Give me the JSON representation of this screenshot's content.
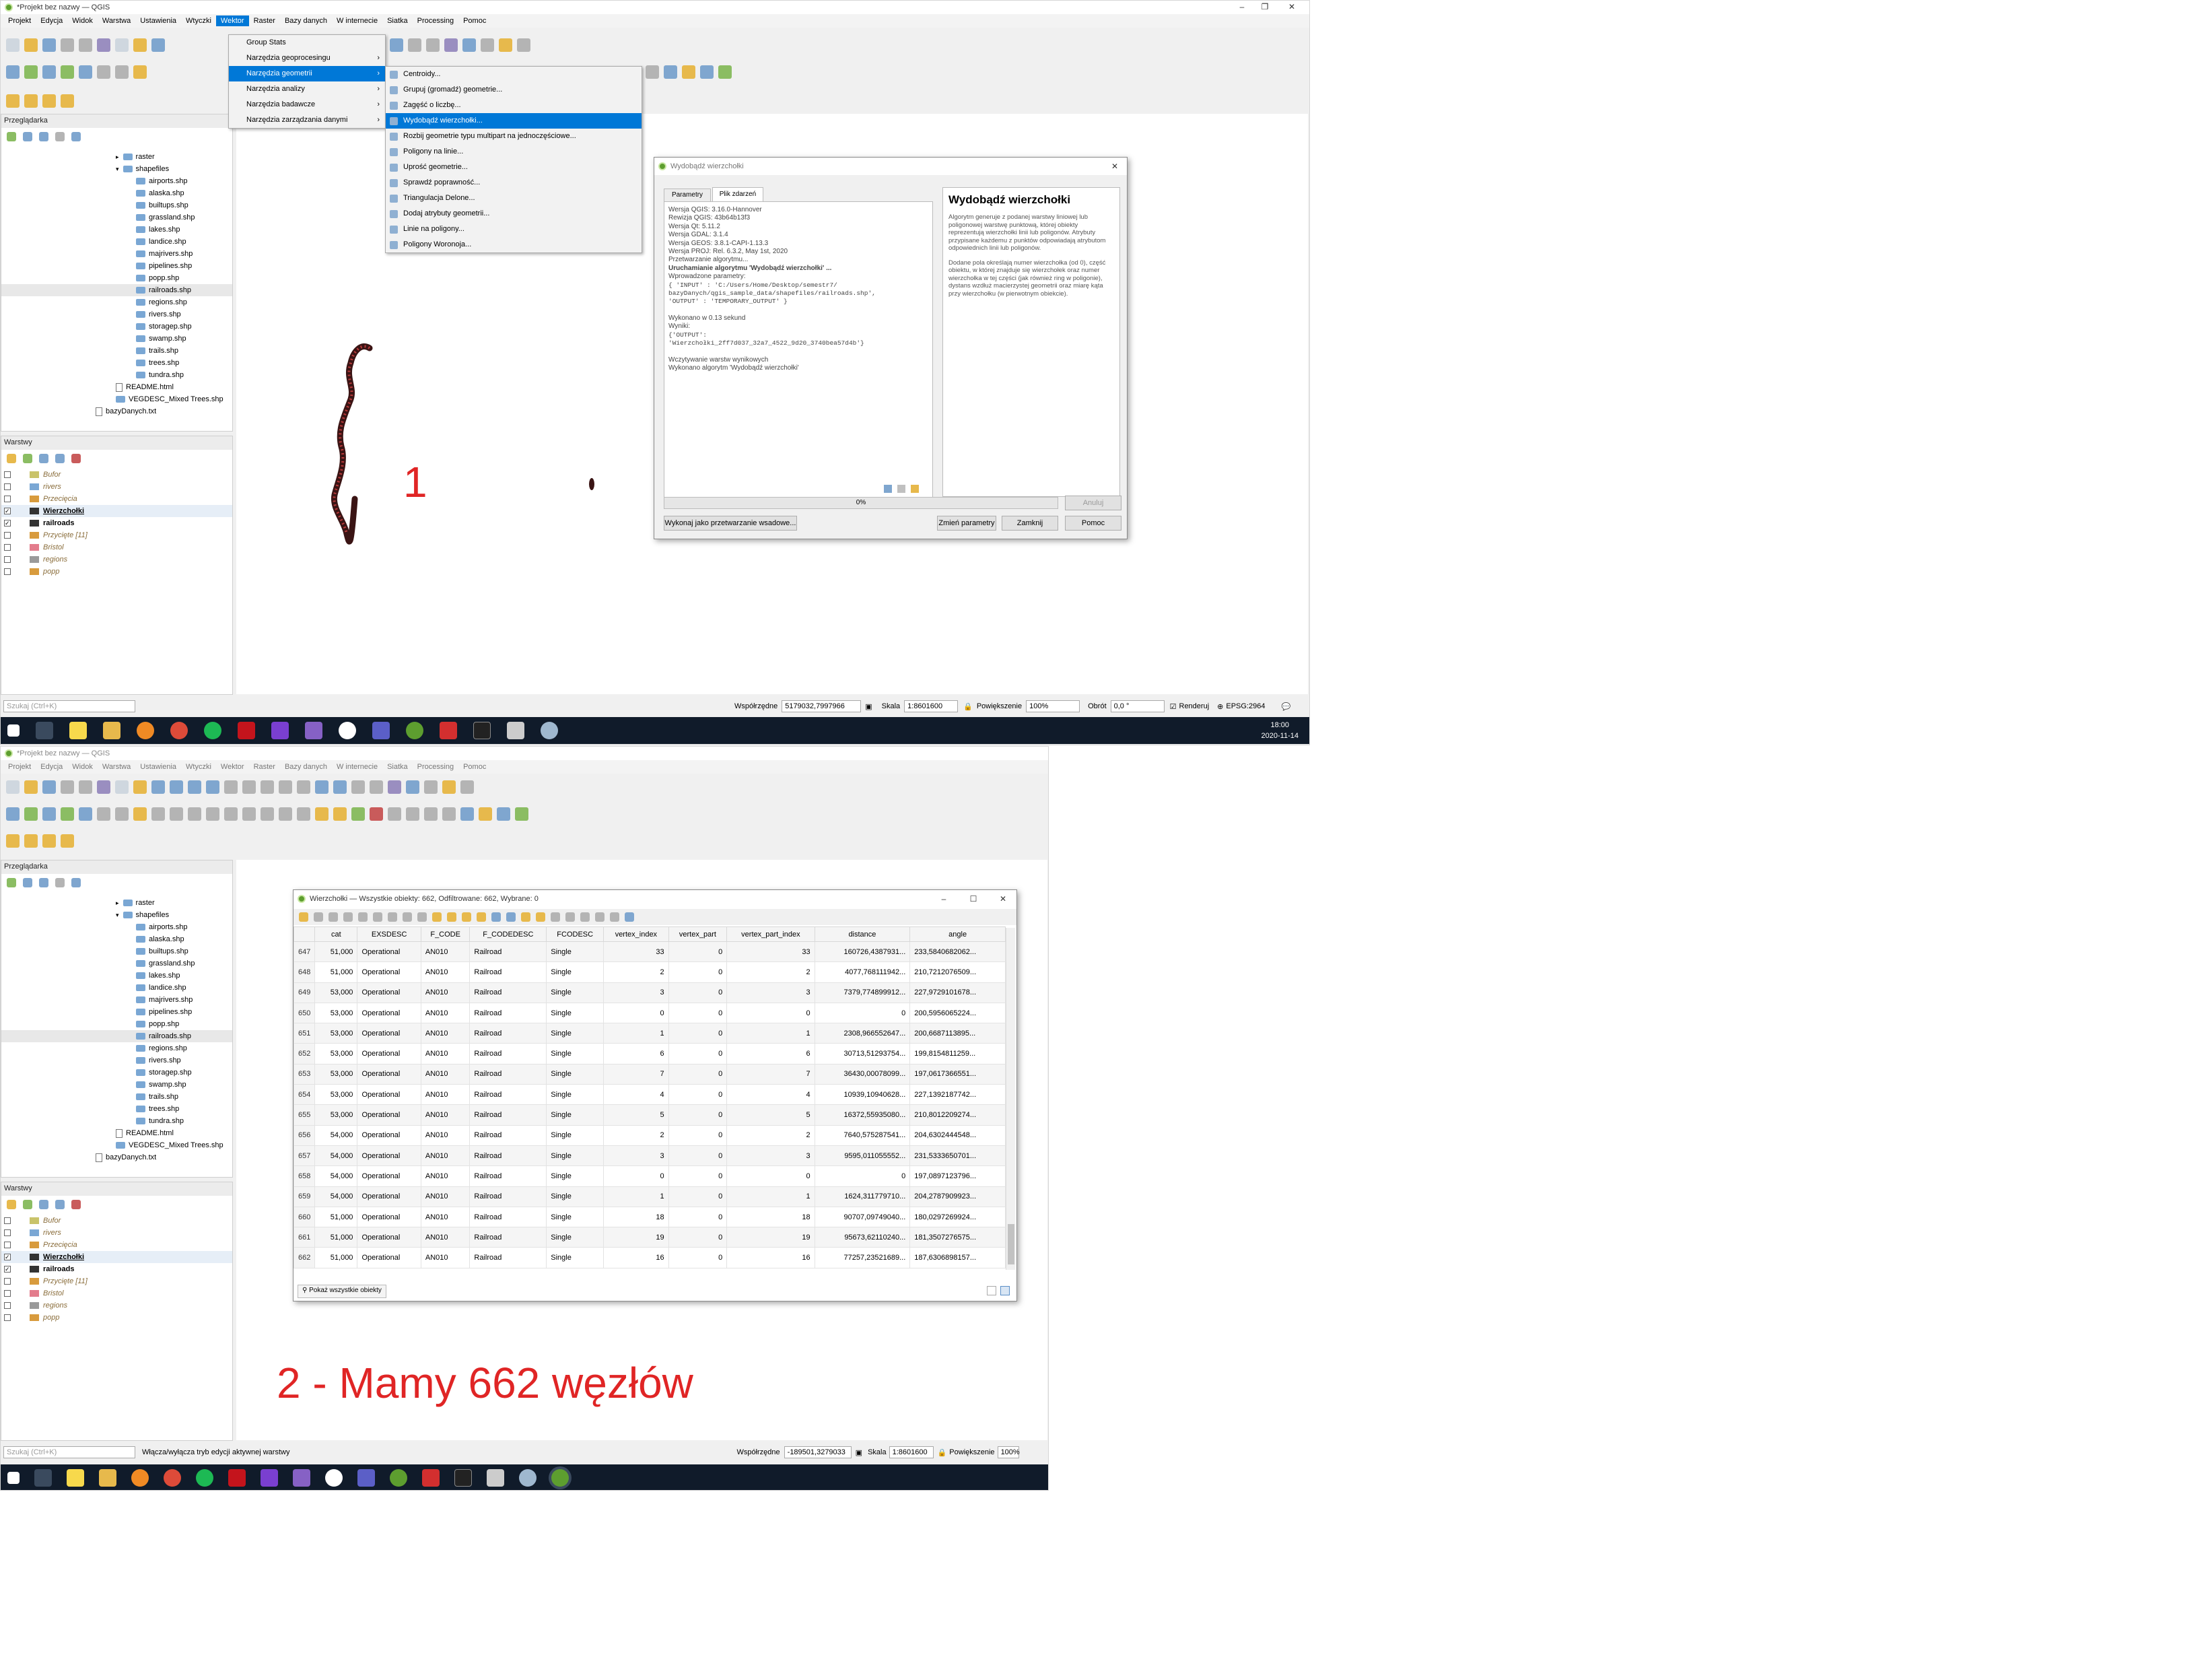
{
  "shot1": {
    "window_title": "*Projekt bez nazwy — QGIS",
    "menu": [
      "Projekt",
      "Edycja",
      "Widok",
      "Warstwa",
      "Ustawienia",
      "Wtyczki",
      "Wektor",
      "Raster",
      "Bazy danych",
      "W internecie",
      "Siatka",
      "Processing",
      "Pomoc"
    ],
    "menu_active": "Wektor",
    "vector_menu": [
      "Group Stats",
      "Narzędzia geoprocesingu",
      "Narzędzia geometrii",
      "Narzędzia analizy",
      "Narzędzia badawcze",
      "Narzędzia zarządzania danymi"
    ],
    "vector_menu_selected": "Narzędzia geometrii",
    "geometry_submenu": [
      "Centroidy...",
      "Grupuj (gromadź) geometrie...",
      "Zagęść o liczbę...",
      "Wydobądź wierzchołki...",
      "Rozbij geometrie typu multipart na jednoczęściowe...",
      "Poligony na linie...",
      "Uprość geometrie...",
      "Sprawdź poprawność...",
      "Triangulacja Delone...",
      "Dodaj atrybuty geometrii...",
      "Linie na poligony...",
      "Poligony Woronoja..."
    ],
    "geometry_submenu_selected": "Wydobądź wierzchołki...",
    "browser_title": "Przeglądarka",
    "browser_items": [
      {
        "name": "raster",
        "type": "folder",
        "indent": 1
      },
      {
        "name": "shapefiles",
        "type": "folder",
        "indent": 1
      },
      {
        "name": "airports.shp",
        "type": "file",
        "indent": 2
      },
      {
        "name": "alaska.shp",
        "type": "file",
        "indent": 2
      },
      {
        "name": "builtups.shp",
        "type": "file",
        "indent": 2
      },
      {
        "name": "grassland.shp",
        "type": "file",
        "indent": 2
      },
      {
        "name": "lakes.shp",
        "type": "file",
        "indent": 2
      },
      {
        "name": "landice.shp",
        "type": "file",
        "indent": 2
      },
      {
        "name": "majrivers.shp",
        "type": "file",
        "indent": 2
      },
      {
        "name": "pipelines.shp",
        "type": "file",
        "indent": 2
      },
      {
        "name": "popp.shp",
        "type": "file",
        "indent": 2
      },
      {
        "name": "railroads.shp",
        "type": "file",
        "indent": 2
      },
      {
        "name": "regions.shp",
        "type": "file",
        "indent": 2
      },
      {
        "name": "rivers.shp",
        "type": "file",
        "indent": 2
      },
      {
        "name": "storagep.shp",
        "type": "file",
        "indent": 2
      },
      {
        "name": "swamp.shp",
        "type": "file",
        "indent": 2
      },
      {
        "name": "trails.shp",
        "type": "file",
        "indent": 2
      },
      {
        "name": "trees.shp",
        "type": "file",
        "indent": 2
      },
      {
        "name": "tundra.shp",
        "type": "file",
        "indent": 2
      },
      {
        "name": "README.html",
        "type": "doc",
        "indent": 1
      },
      {
        "name": "VEGDESC_Mixed Trees.shp",
        "type": "file",
        "indent": 1
      },
      {
        "name": "bazyDanych.txt",
        "type": "doc",
        "indent": 0
      }
    ],
    "layers_title": "Warstwy",
    "layers": [
      {
        "name": "Bufor",
        "checked": false,
        "italic": true,
        "bold": false,
        "color": "#c9c36a"
      },
      {
        "name": "rivers",
        "checked": false,
        "italic": true,
        "bold": false,
        "color": "#7aa7d4"
      },
      {
        "name": "Przecięcia",
        "checked": false,
        "italic": true,
        "bold": false,
        "color": "#d89b3d"
      },
      {
        "name": "Wierzchołki",
        "checked": true,
        "italic": false,
        "bold": true,
        "color": "#333333"
      },
      {
        "name": "railroads",
        "checked": true,
        "italic": false,
        "bold": true,
        "color": "#333333"
      },
      {
        "name": "Przycięte [11]",
        "checked": false,
        "italic": true,
        "bold": false,
        "color": "#d89b3d"
      },
      {
        "name": "Bristol",
        "checked": false,
        "italic": true,
        "bold": false,
        "color": "#e37c8c"
      },
      {
        "name": "regions",
        "checked": false,
        "italic": true,
        "bold": false,
        "color": "#9a9a9a"
      },
      {
        "name": "popp",
        "checked": false,
        "italic": true,
        "bold": false,
        "color": "#d89b3d"
      }
    ],
    "annotation_1": "1",
    "dialog": {
      "title": "Wydobądź wierzchołki",
      "tab_params": "Parametry",
      "tab_log": "Plik zdarzeń",
      "log_lines": [
        "Wersja QGIS: 3.16.0-Hannover",
        "Rewizja QGIS: 43b64b13f3",
        "Wersja Qt: 5.11.2",
        "Wersja GDAL: 3.1.4",
        "Wersja GEOS: 3.8.1-CAPI-1.13.3",
        "Wersja PROJ: Rel. 6.3.2, May 1st, 2020",
        "Przetwarzanie algorytmu...",
        "Uruchamianie algorytmu 'Wydobądź wierzchołki' ...",
        "Wprowadzone parametry:",
        "{ 'INPUT' : 'C:/Users/Home/Desktop/semestr7/",
        "bazyDanych/qgis_sample_data/shapefiles/railroads.shp',",
        "'OUTPUT' : 'TEMPORARY_OUTPUT' }",
        "",
        "Wykonano w 0.13 sekund",
        "Wyniki:",
        "{'OUTPUT':",
        "'Wierzchołki_2ff7d037_32a7_4522_9d20_3740bea57d4b'}",
        "",
        "Wczytywanie warstw wynikowych",
        "Wykonano algorytm 'Wydobądź wierzchołki'"
      ],
      "help_title": "Wydobądź wierzchołki",
      "help_p1": "Algorytm generuje z podanej warstwy liniowej lub poligonowej warstwę punktową, której obiekty reprezentują wierzchołki linii lub poligonów. Atrybuty przypisane każdemu z punktów odpowiadają atrybutom odpowiednich linii lub poligonów.",
      "help_p2": "Dodane pola określają numer wierzchołka (od 0), część obiektu, w której znajduje się wierzchołek oraz numer wierzchołka w tej części (jak również ring w poligonie), dystans wzdłuż macierzystej geometrii oraz miarę kąta przy wierzchołku (w pierwotnym obiekcie).",
      "progress_label": "0%",
      "progress": 0,
      "cancel": "Anuluj",
      "batch": "Wykonaj jako przetwarzanie wsadowe...",
      "change_params": "Zmień parametry",
      "close": "Zamknij",
      "help": "Pomoc"
    },
    "status": {
      "search_placeholder": "Szukaj (Ctrl+K)",
      "coord_label": "Współrzędne",
      "coord_value": "5179032,7997966",
      "scale_label": "Skala",
      "scale_value": "1:8601600",
      "zoom_label": "Powiększenie",
      "zoom_value": "100%",
      "rot_label": "Obrót",
      "rot_value": "0,0 °",
      "render": "Renderuj",
      "crs": "EPSG:2964"
    },
    "clock_time": "18:00",
    "clock_date": "2020-11-14"
  },
  "shot2": {
    "window_title": "*Projekt bez nazwy — QGIS",
    "menu": [
      "Projekt",
      "Edycja",
      "Widok",
      "Warstwa",
      "Ustawienia",
      "Wtyczki",
      "Wektor",
      "Raster",
      "Bazy danych",
      "W internecie",
      "Siatka",
      "Processing",
      "Pomoc"
    ],
    "table_title": "Wierzchołki — Wszystkie obiekty: 662, Odfiltrowane: 662, Wybrane: 0",
    "columns": [
      "cat",
      "EXSDESC",
      "F_CODE",
      "F_CODEDESC",
      "FCODESC",
      "vertex_index",
      "vertex_part",
      "vertex_part_index",
      "distance",
      "angle"
    ],
    "rows": [
      [
        "647",
        "51,000",
        "Operational",
        "AN010",
        "Railroad",
        "Single",
        "33",
        "0",
        "33",
        "160726,4387931...",
        "233,5840682062..."
      ],
      [
        "648",
        "51,000",
        "Operational",
        "AN010",
        "Railroad",
        "Single",
        "2",
        "0",
        "2",
        "4077,768111942...",
        "210,7212076509..."
      ],
      [
        "649",
        "53,000",
        "Operational",
        "AN010",
        "Railroad",
        "Single",
        "3",
        "0",
        "3",
        "7379,774899912...",
        "227,9729101678..."
      ],
      [
        "650",
        "53,000",
        "Operational",
        "AN010",
        "Railroad",
        "Single",
        "0",
        "0",
        "0",
        "0",
        "200,5956065224..."
      ],
      [
        "651",
        "53,000",
        "Operational",
        "AN010",
        "Railroad",
        "Single",
        "1",
        "0",
        "1",
        "2308,966552647...",
        "200,6687113895..."
      ],
      [
        "652",
        "53,000",
        "Operational",
        "AN010",
        "Railroad",
        "Single",
        "6",
        "0",
        "6",
        "30713,51293754...",
        "199,8154811259..."
      ],
      [
        "653",
        "53,000",
        "Operational",
        "AN010",
        "Railroad",
        "Single",
        "7",
        "0",
        "7",
        "36430,00078099...",
        "197,0617366551..."
      ],
      [
        "654",
        "53,000",
        "Operational",
        "AN010",
        "Railroad",
        "Single",
        "4",
        "0",
        "4",
        "10939,10940628...",
        "227,1392187742..."
      ],
      [
        "655",
        "53,000",
        "Operational",
        "AN010",
        "Railroad",
        "Single",
        "5",
        "0",
        "5",
        "16372,55935080...",
        "210,8012209274..."
      ],
      [
        "656",
        "54,000",
        "Operational",
        "AN010",
        "Railroad",
        "Single",
        "2",
        "0",
        "2",
        "7640,575287541...",
        "204,6302444548..."
      ],
      [
        "657",
        "54,000",
        "Operational",
        "AN010",
        "Railroad",
        "Single",
        "3",
        "0",
        "3",
        "9595,011055552...",
        "231,5333650701..."
      ],
      [
        "658",
        "54,000",
        "Operational",
        "AN010",
        "Railroad",
        "Single",
        "0",
        "0",
        "0",
        "0",
        "197,0897123796..."
      ],
      [
        "659",
        "54,000",
        "Operational",
        "AN010",
        "Railroad",
        "Single",
        "1",
        "0",
        "1",
        "1624,311779710...",
        "204,2787909923..."
      ],
      [
        "660",
        "51,000",
        "Operational",
        "AN010",
        "Railroad",
        "Single",
        "18",
        "0",
        "18",
        "90707,09749040...",
        "180,0297269924..."
      ],
      [
        "661",
        "51,000",
        "Operational",
        "AN010",
        "Railroad",
        "Single",
        "19",
        "0",
        "19",
        "95673,62110240...",
        "181,3507276575..."
      ],
      [
        "662",
        "51,000",
        "Operational",
        "AN010",
        "Railroad",
        "Single",
        "16",
        "0",
        "16",
        "77257,23521689...",
        "187,6306898157..."
      ]
    ],
    "show_all": "Pokaż wszystkie obiekty",
    "annotation_2": "2 - Mamy 662 węzłów",
    "status_hint": "Włącza/wyłącza tryb edycji aktywnej warstwy",
    "search_placeholder": "Szukaj (Ctrl+K)",
    "coord_label": "Współrzędne",
    "coord_value": "-189501,3279033",
    "scale_label": "Skala",
    "scale_value": "1:8601600",
    "zoom_label": "Powiększenie",
    "zoom_value": "100%"
  },
  "colors": {
    "accent": "#0078d7",
    "annotation": "#e02525",
    "taskbar": "#101b2a",
    "qgis_green": "#5d9e2f"
  }
}
